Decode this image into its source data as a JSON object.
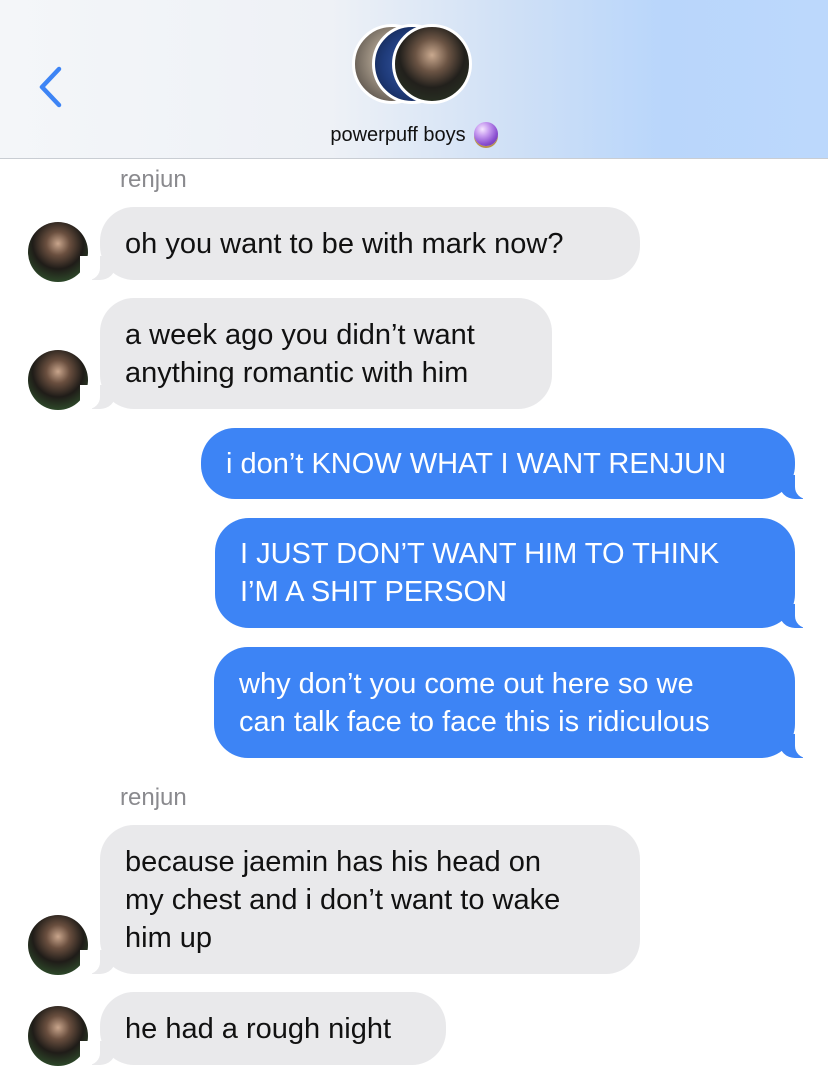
{
  "header": {
    "title": "powerpuff boys",
    "title_emoji_icon": "crystal-ball-icon",
    "back_icon": "chevron-left-icon",
    "accent_color": "#3d84f5"
  },
  "messages": [
    {
      "sender": "renjun"
    },
    {
      "direction": "incoming",
      "text": "oh you want to be with mark now?"
    },
    {
      "direction": "incoming",
      "lines": [
        "a week ago you didn’t want",
        "anything romantic with him"
      ]
    },
    {
      "direction": "outgoing",
      "text": "i don’t KNOW WHAT I WANT RENJUN"
    },
    {
      "direction": "outgoing",
      "lines": [
        "I JUST DON’T WANT HIM TO THINK",
        "I’M A SHIT PERSON"
      ]
    },
    {
      "direction": "outgoing",
      "lines": [
        "why don’t you come out here so we",
        "can talk face to face this is ridiculous"
      ]
    },
    {
      "sender": "renjun"
    },
    {
      "direction": "incoming",
      "lines": [
        "because jaemin has his head on",
        "my chest and i don’t want to wake",
        "him up"
      ]
    },
    {
      "direction": "incoming",
      "text": "he had a rough night"
    }
  ],
  "colors": {
    "incoming_bubble": "#e9e9eb",
    "outgoing_bubble": "#3d84f5"
  }
}
